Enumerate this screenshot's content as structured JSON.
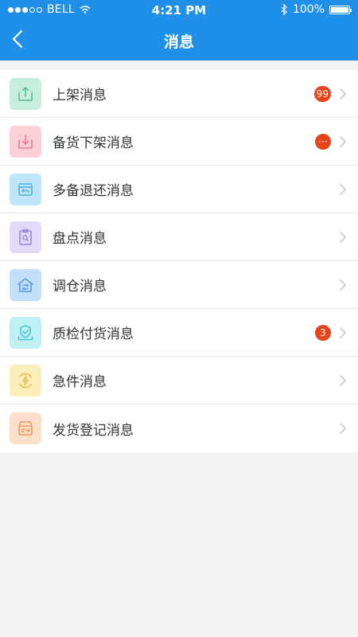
{
  "status_bar": {
    "carrier": "BELL",
    "time": "4:21 PM",
    "battery": "100%"
  },
  "nav": {
    "title": "消息"
  },
  "colors": {
    "primary": "#1f8fe8",
    "badge": "#e8431b"
  },
  "items": [
    {
      "label": "上架消息",
      "badge": "99",
      "icon": "shelf-up-icon",
      "icon_bg": "#c7eddc",
      "icon_color": "#5cbf8f"
    },
    {
      "label": "备货下架消息",
      "badge": "···",
      "icon": "shelf-down-icon",
      "icon_bg": "#fbd0d7",
      "icon_color": "#ef7a8a"
    },
    {
      "label": "多备退还消息",
      "badge": "",
      "icon": "return-icon",
      "icon_bg": "#bfe6f8",
      "icon_color": "#4bb2e2"
    },
    {
      "label": "盘点消息",
      "badge": "",
      "icon": "inventory-check-icon",
      "icon_bg": "#e3d9f9",
      "icon_color": "#9a84df"
    },
    {
      "label": "调仓消息",
      "badge": "",
      "icon": "warehouse-transfer-icon",
      "icon_bg": "#c3def8",
      "icon_color": "#5a9be0"
    },
    {
      "label": "质检付货消息",
      "badge": "3",
      "icon": "quality-check-icon",
      "icon_bg": "#bff0f3",
      "icon_color": "#4ac6d1"
    },
    {
      "label": "急件消息",
      "badge": "",
      "icon": "urgent-icon",
      "icon_bg": "#fbeeba",
      "icon_color": "#e9c24b"
    },
    {
      "label": "发货登记消息",
      "badge": "",
      "icon": "shipping-register-icon",
      "icon_bg": "#fde0cb",
      "icon_color": "#ef9a62"
    }
  ]
}
